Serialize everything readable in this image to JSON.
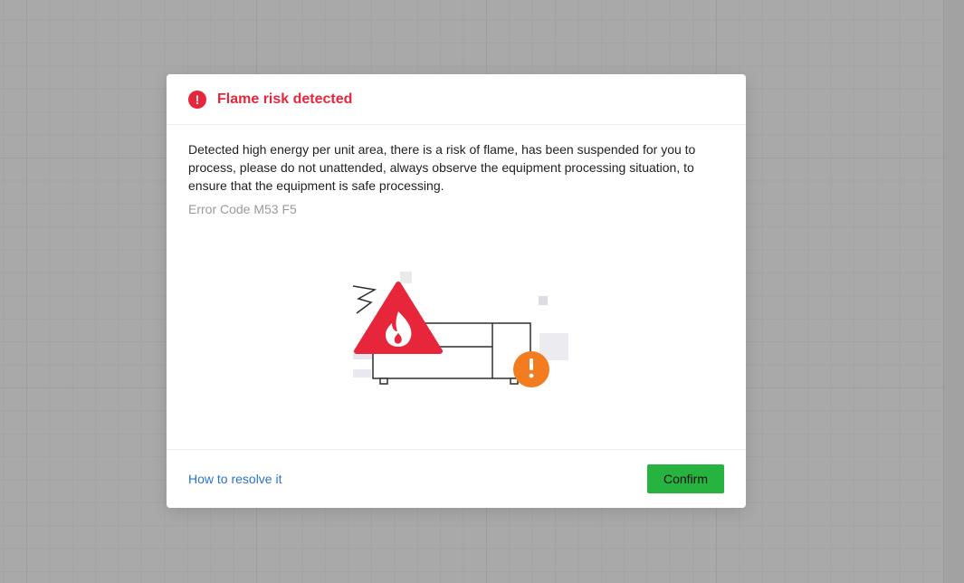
{
  "dialog": {
    "title": "Flame risk detected",
    "message": "Detected high energy per unit area, there is a risk of flame, has been suspended for you to process, please do not unattended, always observe the equipment processing situation, to ensure that the equipment is safe processing.",
    "error_code": "Error Code M53 F5",
    "alert_icon": "exclamation-circle-icon",
    "illustration_icons": [
      "flame-warning-icon",
      "exclamation-badge-icon"
    ],
    "colors": {
      "danger": "#e8263b",
      "link": "#2a73c9",
      "confirm": "#27b33f",
      "warning_badge": "#f47c20"
    }
  },
  "footer": {
    "resolve_link": "How to resolve it",
    "confirm_label": "Confirm"
  }
}
